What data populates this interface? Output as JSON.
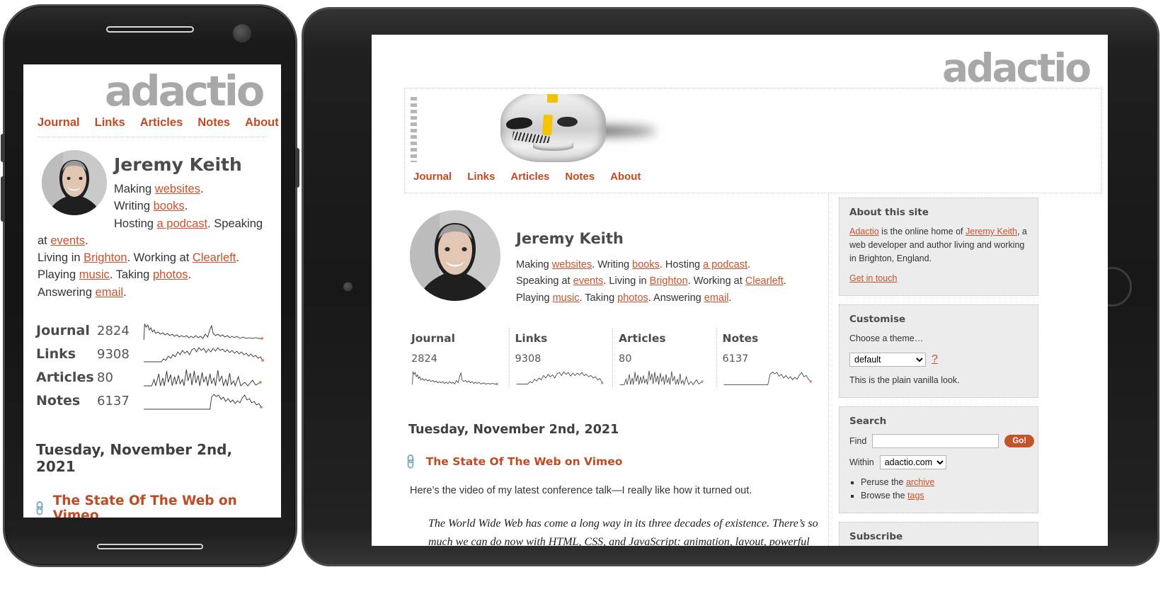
{
  "site": {
    "logo": "adactio",
    "nav": [
      "Journal",
      "Links",
      "Articles",
      "Notes",
      "About"
    ]
  },
  "profile": {
    "name": "Jeremy Keith",
    "bio_parts": [
      {
        "text": "Making ",
        "link": false
      },
      {
        "text": "websites",
        "link": true
      },
      {
        "text": ". Writing ",
        "link": false
      },
      {
        "text": "books",
        "link": true
      },
      {
        "text": ". Hosting ",
        "link": false
      },
      {
        "text": "a podcast",
        "link": true
      },
      {
        "text": ". Speaking at ",
        "link": false
      },
      {
        "text": "events",
        "link": true
      },
      {
        "text": ". Living in ",
        "link": false
      },
      {
        "text": "Brighton",
        "link": true
      },
      {
        "text": ". Working at ",
        "link": false
      },
      {
        "text": "Clearleft",
        "link": true
      },
      {
        "text": ". Playing ",
        "link": false
      },
      {
        "text": "music",
        "link": true
      },
      {
        "text": ". Taking ",
        "link": false
      },
      {
        "text": "photos",
        "link": true
      },
      {
        "text": ". Answering ",
        "link": false
      },
      {
        "text": "email",
        "link": true
      },
      {
        "text": ".",
        "link": false
      }
    ],
    "phone_lines": {
      "l1_pre": "Making ",
      "l1_link": "websites",
      "l1_post": ".",
      "l2_pre": "Writing ",
      "l2_link": "books",
      "l2_post": ".",
      "l3_pre": "Hosting ",
      "l3_link": "a podcast",
      "l3_mid": ". Speaking at ",
      "l3_link2": "events",
      "l3_post": ".",
      "l4_pre": "Living in ",
      "l4_link": "Brighton",
      "l4_mid": ". Working at ",
      "l4_link2": "Clearleft",
      "l4_post": ".",
      "l5_pre": "Playing ",
      "l5_link": "music",
      "l5_mid": ". Taking ",
      "l5_link2": "photos",
      "l5_post": ".",
      "l6_pre": "Answering ",
      "l6_link": "email",
      "l6_post": "."
    },
    "tablet_lines": {
      "t1_pre": "Making ",
      "t1_l1": "websites",
      "t1_m1": ". Writing ",
      "t1_l2": "books",
      "t1_m2": ". Hosting ",
      "t1_l3": "a podcast",
      "t1_end": ".",
      "t2_pre": "Speaking at ",
      "t2_l1": "events",
      "t2_m1": ". Living in ",
      "t2_l2": "Brighton",
      "t2_m2": ". Working at ",
      "t2_l3": "Clearleft",
      "t2_end": ".",
      "t3_pre": "Playing ",
      "t3_l1": "music",
      "t3_m1": ". Taking ",
      "t3_l2": "photos",
      "t3_m2": ". Answering ",
      "t3_l3": "email",
      "t3_end": "."
    }
  },
  "stats": [
    {
      "name": "Journal",
      "count": "2824"
    },
    {
      "name": "Links",
      "count": "9308"
    },
    {
      "name": "Articles",
      "count": "80"
    },
    {
      "name": "Notes",
      "count": "6137"
    }
  ],
  "post": {
    "date": "Tuesday, November 2nd, 2021",
    "title": "The State Of The Web on Vimeo",
    "lead": "Here’s the video of my latest conference talk—I really like how it turned out.",
    "quote_line1": "The World Wide Web has come a long way in its three decades of existence.",
    "quote_line2": "There’s so much we can do now with HTML, CSS, and JavaScript: animation,",
    "quote_line3": "layout, powerful APIs… we can even make websites that work offline! And yet"
  },
  "sidebar": {
    "about": {
      "title": "About this site",
      "p_l1": "Adactio",
      "p_m1": " is the online home of ",
      "p_l2": "Jeremy Keith",
      "p_m2": ", a web developer and author living and working in Brighton, England.",
      "contact_link": "Get in touch"
    },
    "customise": {
      "title": "Customise",
      "label": "Choose a theme…",
      "theme_selected": "default",
      "theme_options": [
        "default"
      ],
      "help": "?",
      "note": "This is the plain vanilla look."
    },
    "search": {
      "title": "Search",
      "find_label": "Find",
      "find_value": "",
      "go_label": "Go!",
      "within_label": "Within",
      "within_selected": "adactio.com",
      "within_options": [
        "adactio.com"
      ],
      "item1_pre": "Peruse the ",
      "item1_link": "archive",
      "item2_pre": "Browse the ",
      "item2_link": "tags"
    },
    "subscribe": {
      "title": "Subscribe"
    }
  },
  "colors": {
    "link": "#c8512a",
    "nav": "#c14a22",
    "logo": "#a8a8a8",
    "module_bg": "#ececec",
    "spark_dot": "#e08050"
  }
}
